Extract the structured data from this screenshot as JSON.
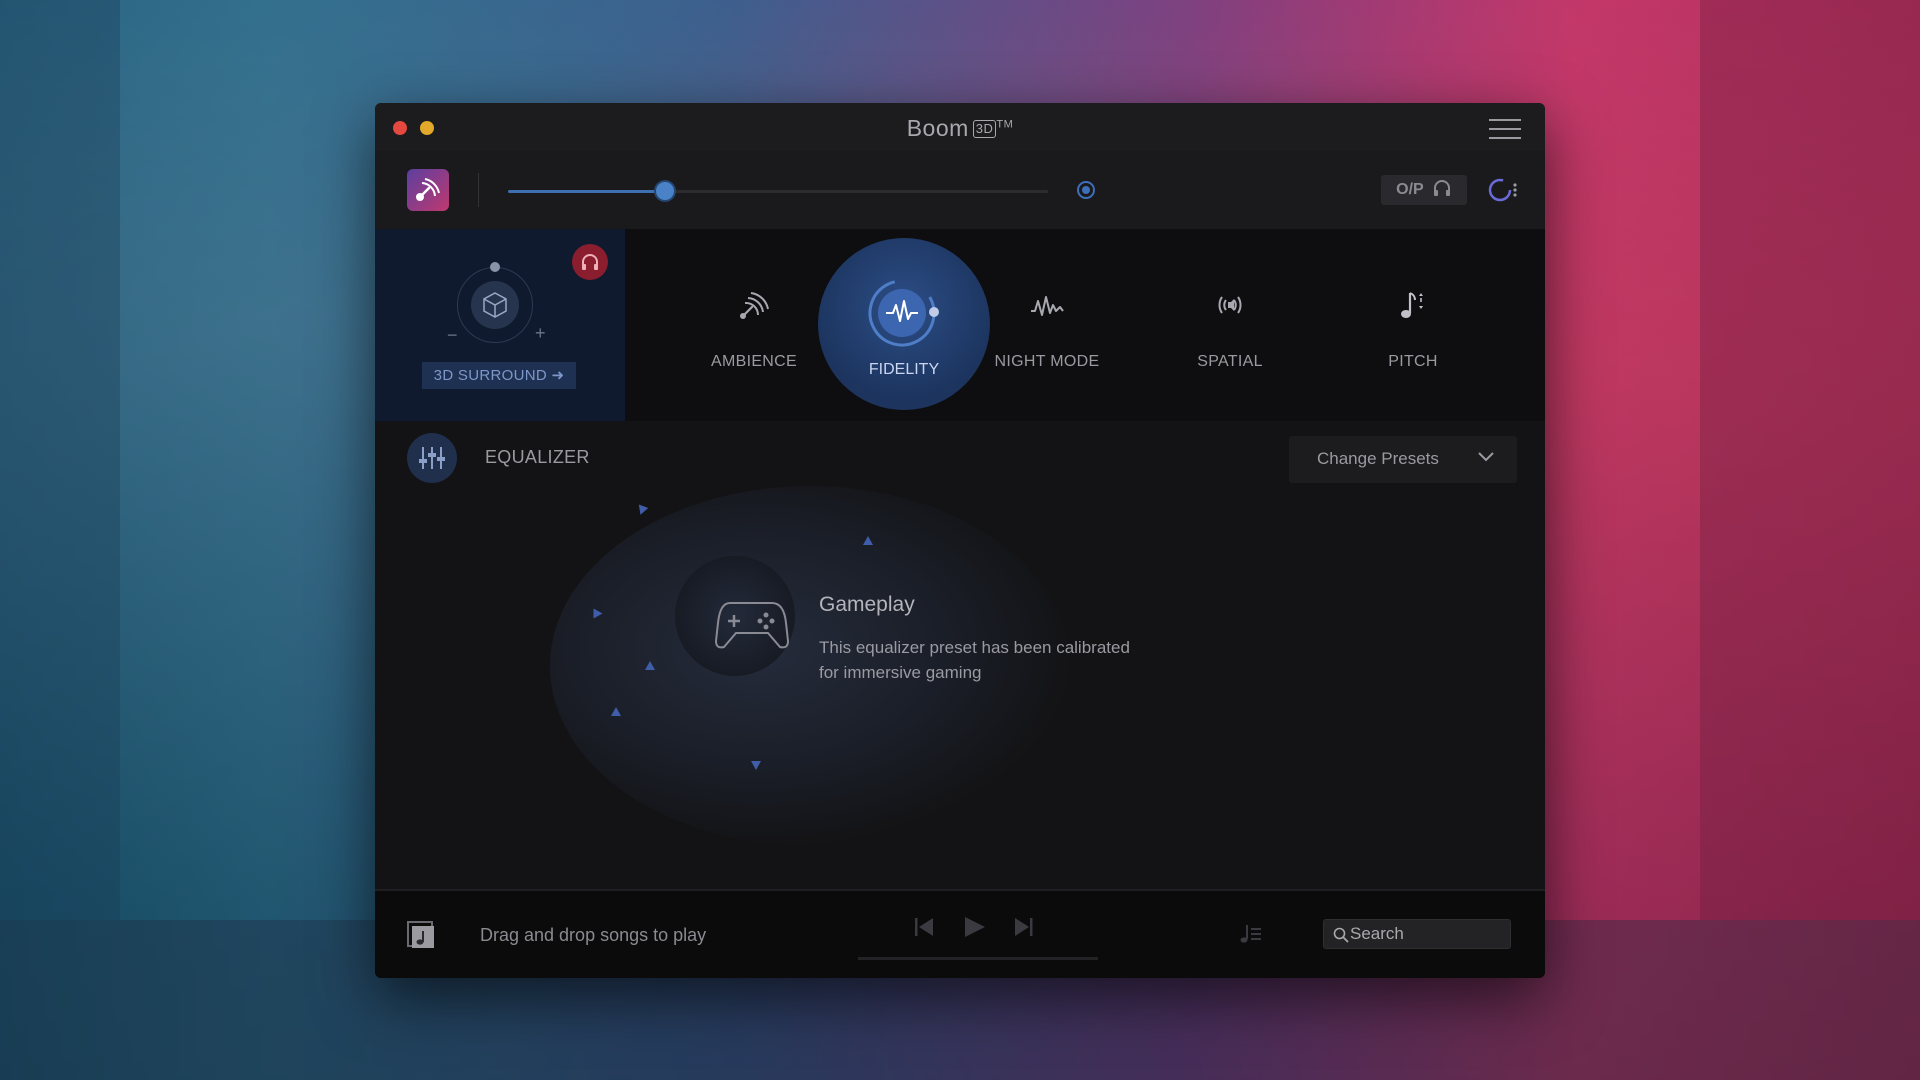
{
  "window": {
    "title": "Boom",
    "title_badge": "3D",
    "title_trademark": "TM"
  },
  "volume": {
    "level": 0.29,
    "output_label": "O/P"
  },
  "surround": {
    "button_label": "3D SURROUND",
    "minus": "−",
    "plus": "+"
  },
  "effects": [
    {
      "label": "AMBIENCE",
      "icon": "ambience-icon",
      "active": false
    },
    {
      "label": "FIDELITY",
      "icon": "fidelity-icon",
      "active": true
    },
    {
      "label": "NIGHT MODE",
      "icon": "night-mode-icon",
      "active": false
    },
    {
      "label": "SPATIAL",
      "icon": "spatial-icon",
      "active": false
    },
    {
      "label": "PITCH",
      "icon": "pitch-icon",
      "active": false
    }
  ],
  "equalizer": {
    "title": "EQUALIZER",
    "presets_label": "Change Presets",
    "preset_name": "Gameplay",
    "preset_description": "This equalizer preset has been calibrated for immersive gaming"
  },
  "player": {
    "drag_text": "Drag and drop songs to play",
    "search_placeholder": "Search"
  },
  "colors": {
    "accent_blue": "#4a82c8",
    "headphone_badge": "#8a1d2e",
    "fidelity_active": "#2c4d86"
  }
}
